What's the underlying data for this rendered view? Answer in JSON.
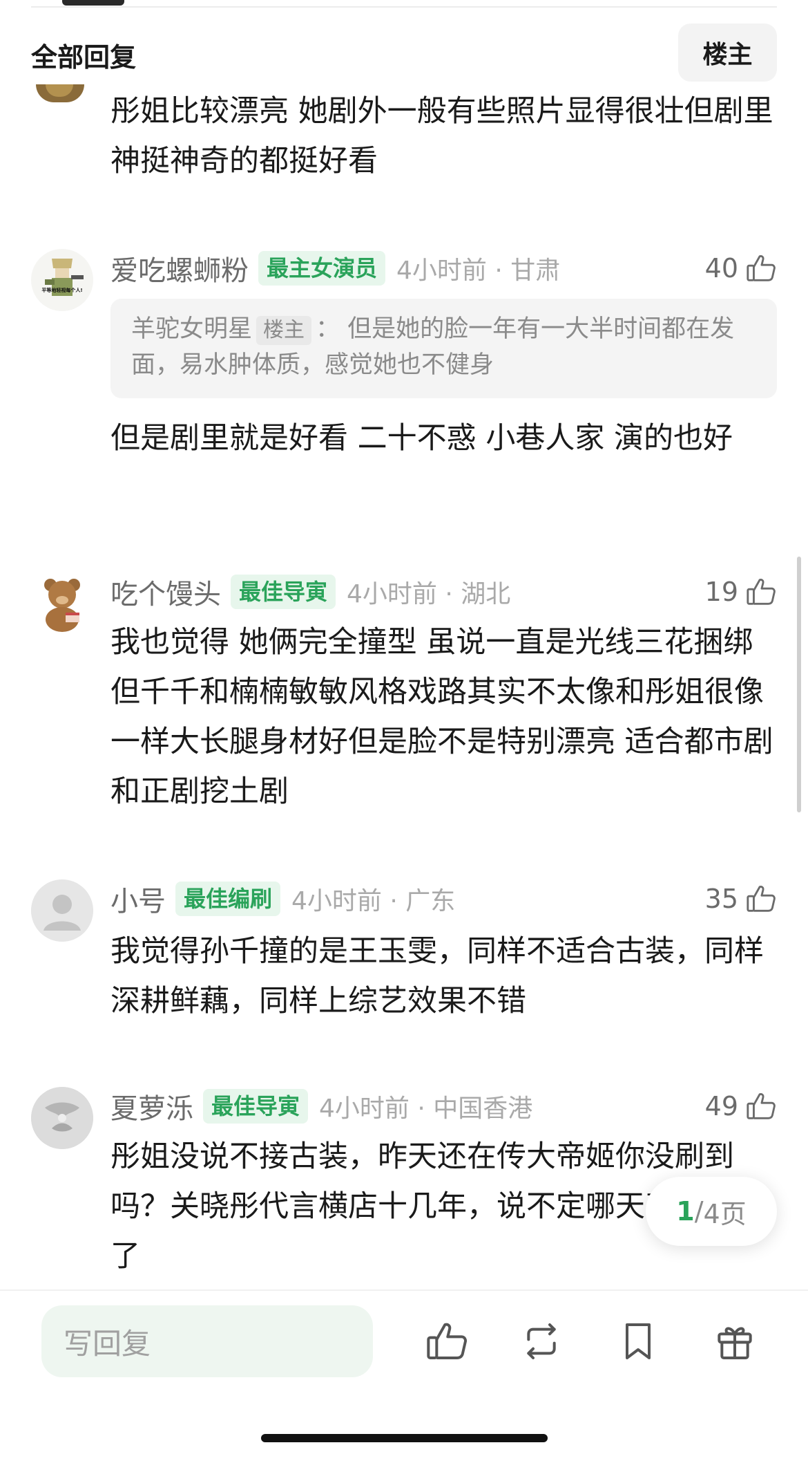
{
  "header": {
    "title": "全部回复",
    "op_button": "楼主"
  },
  "prev_comment": {
    "text": "彤姐比较漂亮 她剧外一般有些照片显得很壮但剧里神挺神奇的都挺好看"
  },
  "comments": [
    {
      "username": "爱吃螺蛳粉",
      "badge": "最主女演员",
      "time_loc": "4小时前 · 甘肃",
      "likes": "40",
      "avatar_text": "平等地轻视每个人!",
      "quote": {
        "author": "羊驼女明星",
        "author_tag": "楼主",
        "sep": "：",
        "text": "但是她的脸一年有一大半时间都在发面，易水肿体质，感觉她也不健身"
      },
      "text": "但是剧里就是好看 二十不惑 小巷人家 演的也好"
    },
    {
      "username": "吃个馒头",
      "badge": "最佳导寅",
      "time_loc": "4小时前 · 湖北",
      "likes": "19",
      "text": "我也觉得 她俩完全撞型 虽说一直是光线三花捆绑 但千千和楠楠敏敏风格戏路其实不太像和彤姐很像 一样大长腿身材好但是脸不是特别漂亮 适合都市剧和正剧挖土剧"
    },
    {
      "username": "小号",
      "badge": "最佳编刷",
      "time_loc": "4小时前 · 广东",
      "likes": "35",
      "text": "我觉得孙千撞的是王玉雯，同样不适合古装，同样深耕鲜藕，同样上综艺效果不错"
    },
    {
      "username": "夏萝泺",
      "badge": "最佳导寅",
      "time_loc": "4小时前 · 中国香港",
      "likes": "49",
      "text": "彤姐没说不接古装，昨天还在传大帝姬你没刷到吗？关晓彤代言横店十几年，说不定哪天真回横店了"
    }
  ],
  "pagination": {
    "current": "1",
    "sep": "/",
    "total": "4页"
  },
  "bottom_bar": {
    "reply_placeholder": "写回复"
  },
  "colors": {
    "accent_green": "#2aa35a",
    "badge_bg": "#e7f6ec"
  }
}
